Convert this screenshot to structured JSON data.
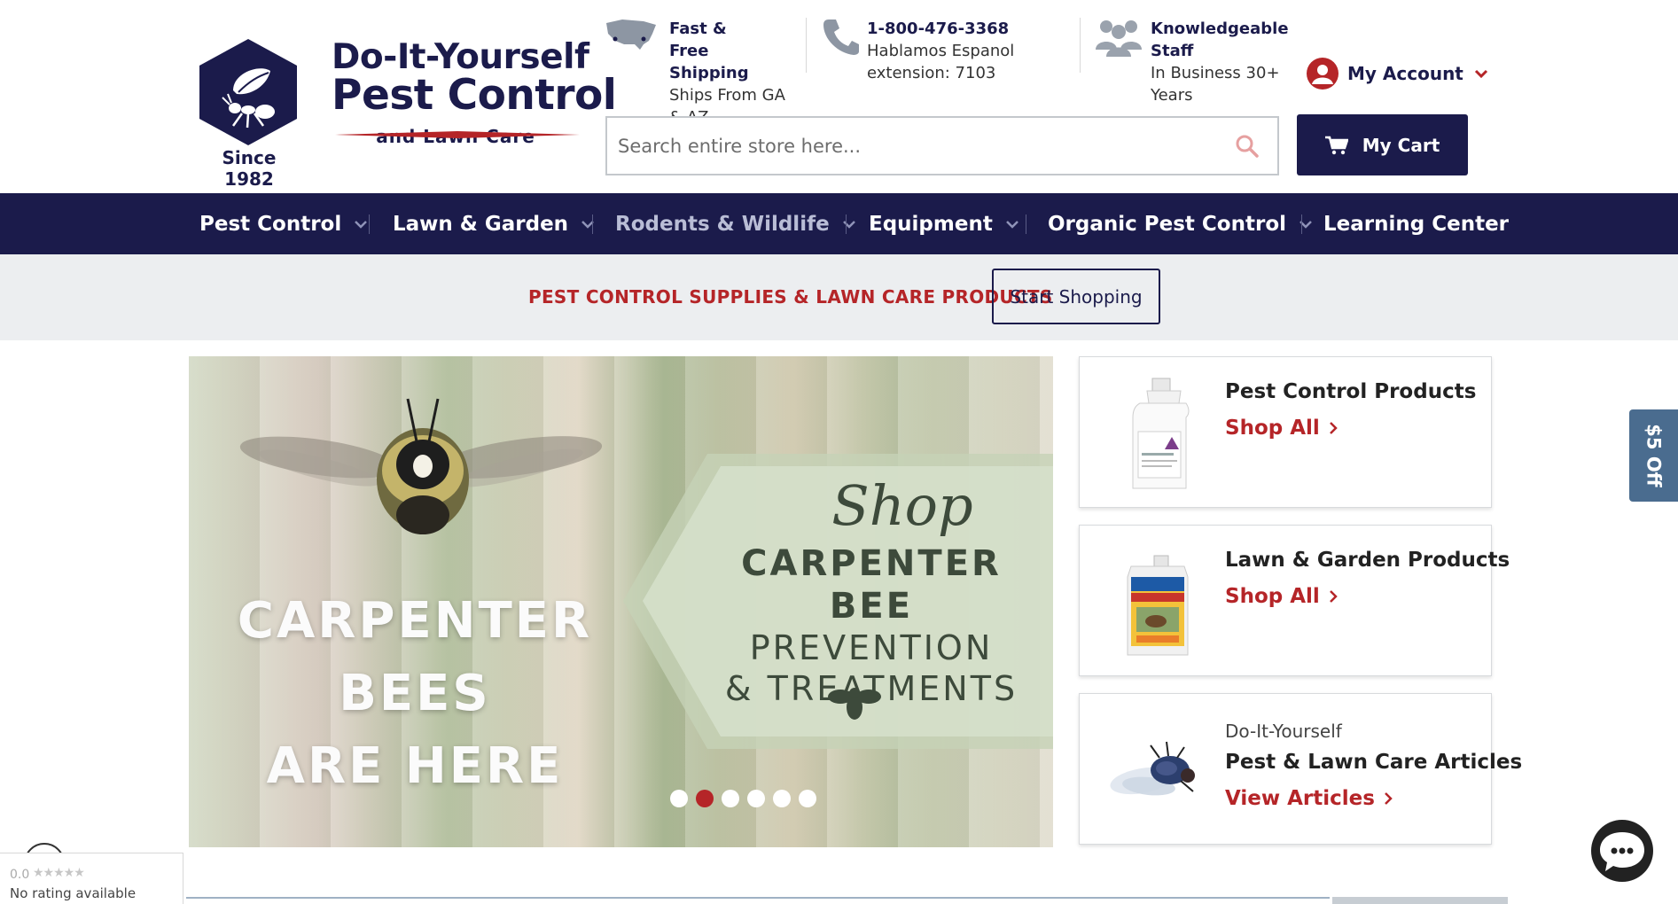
{
  "logo": {
    "brand_line1": "Do-It-Yourself",
    "brand_line2": "Pest Control",
    "brand_line3": "and Lawn Care",
    "since": "Since 1982",
    "colors": {
      "navy": "#1b1b4b",
      "red": "#b52528"
    }
  },
  "header_info": [
    {
      "icon": "usa-map-icon",
      "title": "Fast & Free Shipping",
      "line1": "Ships From GA",
      "line2": "& AZ"
    },
    {
      "icon": "phone-icon",
      "title": "1-800-476-3368",
      "line1": "Hablamos Espanol",
      "line2": "extension: 7103"
    },
    {
      "icon": "staff-group-icon",
      "title": "Knowledgeable Staff",
      "line1": "In Business 30+",
      "line2": "Years"
    }
  ],
  "account": {
    "label": "My Account"
  },
  "search": {
    "placeholder": "Search entire store here..."
  },
  "cart": {
    "label": "My Cart"
  },
  "nav": {
    "items": [
      {
        "label": "Pest Control",
        "has_dropdown": true
      },
      {
        "label": "Lawn & Garden",
        "has_dropdown": true
      },
      {
        "label": "Rodents & Wildlife",
        "has_dropdown": true
      },
      {
        "label": "Equipment",
        "has_dropdown": true
      },
      {
        "label": "Organic Pest Control",
        "has_dropdown": true
      },
      {
        "label": "Learning Center",
        "has_dropdown": false
      }
    ]
  },
  "promo": {
    "text": "PEST CONTROL SUPPLIES & LAWN CARE PRODUCTS",
    "button": "Start Shopping"
  },
  "hero": {
    "left_line1": "CARPENTER",
    "left_line2": "BEES",
    "left_line3": "ARE HERE",
    "shop": "Shop",
    "badge_line1": "CARPENTER BEE",
    "badge_line2": "PREVENTION",
    "badge_line3": "& TREATMENTS",
    "slide_count": 6,
    "active_slide": 2
  },
  "cards": [
    {
      "kicker": "",
      "title": "Pest Control Products",
      "link": "Shop All"
    },
    {
      "kicker": "",
      "title": "Lawn & Garden Products",
      "link": "Shop All"
    },
    {
      "kicker": "Do-It-Yourself",
      "title": "Pest & Lawn Care Articles",
      "link": "View Articles"
    }
  ],
  "side_tab": {
    "label": "$5 Off"
  },
  "rating_widget": {
    "score": "0.0",
    "stars": "★★★★★",
    "text": "No rating available"
  }
}
